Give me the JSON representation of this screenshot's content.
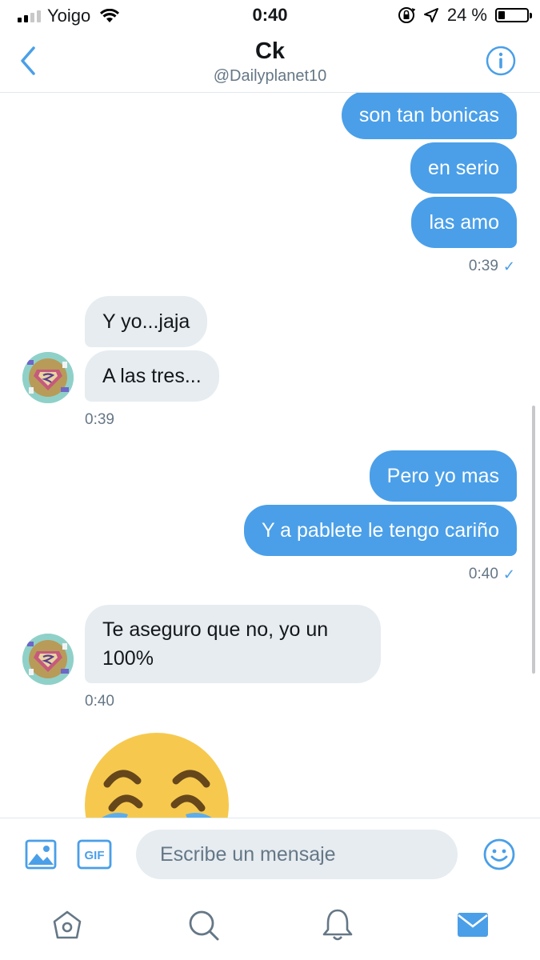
{
  "status_bar": {
    "carrier": "Yoigo",
    "time": "0:40",
    "battery": "24 %",
    "battery_level": 0.24,
    "signal_bars_filled": 2,
    "signal_bars_total": 4
  },
  "header": {
    "name": "Ck",
    "handle": "@Dailyplanet10"
  },
  "colors": {
    "accent": "#4a9fe8",
    "incoming_bubble": "#e6ecf0",
    "muted_text": "#657786"
  },
  "messages": [
    {
      "direction": "out",
      "text": "son tan bonicas"
    },
    {
      "direction": "out",
      "text": "en serio"
    },
    {
      "direction": "out",
      "text": "las amo"
    },
    {
      "direction": "out",
      "timestamp": "0:39"
    },
    {
      "direction": "in",
      "text": "Y yo...jaja"
    },
    {
      "direction": "in",
      "text": "A las tres..."
    },
    {
      "direction": "in",
      "timestamp": "0:39"
    },
    {
      "direction": "out",
      "text": "Pero yo mas"
    },
    {
      "direction": "out",
      "text": "Y a pablete le tengo cariño"
    },
    {
      "direction": "out",
      "timestamp": "0:40"
    },
    {
      "direction": "in",
      "text": "Te aseguro que no, yo un 100%"
    },
    {
      "direction": "in",
      "timestamp": "0:40"
    },
    {
      "direction": "in",
      "emoji": "face-with-tears-of-joy"
    }
  ],
  "composer": {
    "placeholder": "Escribe un mensaje",
    "gif_label": "GIF"
  },
  "tab_bar": {
    "items": [
      "home-icon",
      "search-icon",
      "notifications-icon",
      "messages-icon"
    ],
    "active": "messages-icon"
  }
}
